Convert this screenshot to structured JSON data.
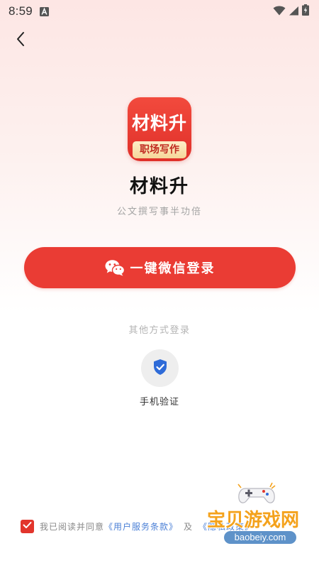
{
  "status_bar": {
    "time": "8:59"
  },
  "header": {
    "back_icon": "chevron-left-icon"
  },
  "app": {
    "logo_main_text": "材料升",
    "logo_ribbon_text": "职场写作",
    "name": "材料升",
    "slogan": "公文撰写事半功倍"
  },
  "login": {
    "wechat_button_label": "一键微信登录",
    "other_methods_label": "其他方式登录",
    "phone_verify_label": "手机验证"
  },
  "agreement": {
    "checked": true,
    "prefix_text": "我已阅读并同意",
    "user_terms_link": "《用户服务条款》",
    "and_text": "及",
    "privacy_link": "《隐私政策》"
  },
  "watermark": {
    "main_text": "宝贝游戏网",
    "sub_text": "baobeiy.com"
  },
  "colors": {
    "accent": "#ea3c34",
    "link": "#4a7fd6",
    "shield": "#2e6bd8"
  }
}
